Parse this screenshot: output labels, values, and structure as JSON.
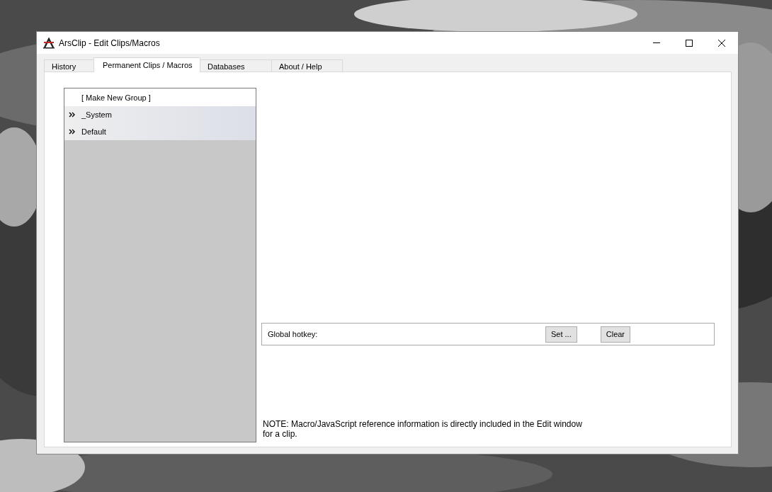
{
  "window": {
    "title": "ArsClip - Edit Clips/Macros"
  },
  "tabs": [
    {
      "label": "History",
      "selected": false
    },
    {
      "label": "Permanent Clips / Macros",
      "selected": true
    },
    {
      "label": "Databases",
      "selected": false
    },
    {
      "label": "About / Help",
      "selected": false
    }
  ],
  "groups": [
    {
      "label": "[ Make New Group ]",
      "kind": "action"
    },
    {
      "label": "_System",
      "kind": "group"
    },
    {
      "label": "Default",
      "kind": "group"
    }
  ],
  "hotkey": {
    "label": "Global hotkey:",
    "buttons": [
      "Set ...",
      "Clear"
    ]
  },
  "note": "NOTE: Macro/JavaScript reference information is directly included in the Edit window for a clip."
}
